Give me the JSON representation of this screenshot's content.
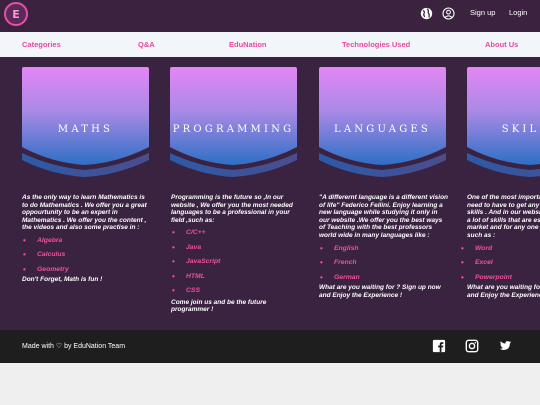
{
  "brand": {
    "logo_letter": "E",
    "logo_color": "#e84fa5"
  },
  "topbar": {
    "bg": "#3b2340",
    "icons": [
      "globe-icon",
      "user-circle-icon"
    ],
    "signup": "Sign up",
    "login": "Login"
  },
  "nav": {
    "items": [
      "Categories",
      "Q&A",
      "EduNation",
      "Technologies Used",
      "About Us"
    ],
    "color": "#e8489c"
  },
  "cards": [
    {
      "title": "MATHS",
      "paragraph": "As the only way to learn Mathematics is to do Mathematics . We offer you a great oppourtunity to be an expert in Mathematics . We offer you the content , the videos and also some practise in :",
      "items": [
        "Algebra",
        "Calculus",
        "Geometry"
      ],
      "after": "Don't Forget, Math is fun !"
    },
    {
      "title": "PROGRAMMING",
      "paragraph": "Programming is the future so ,In our website , We offer you the most needed languages to be a professional in your field ,such as:",
      "items": [
        "C/C++",
        "Java",
        "JavaScript",
        "HTML",
        "CSS"
      ],
      "after": "Come join us and be the future programmer !"
    },
    {
      "title": "LANGUAGES",
      "paragraph": "\"A differernt language is a different vision of life\" Federico Fellini. Enjoy learning a new language while studying it only in our website .We offer you the best ways of Teaching with the best professors world wide in many languages like :",
      "items": [
        "English",
        "French",
        "German"
      ],
      "after": "What are you waiting for ? Sign up now and Enjoy the Experience !"
    },
    {
      "title": "SKILLS",
      "paragraph": "One of the most important things you need to have to get any job is powerful skills . And in our website we provide you a lot of skills that are essential in the job market and for any one keen to learn, such as :",
      "items": [
        "Word",
        "Excel",
        "Powerpoint"
      ],
      "after": "What are you waiting for ? Sign up now and Enjoy the Experience !"
    }
  ],
  "footer": {
    "text": "Made with ♡ by EduNation Team",
    "icons": [
      "facebook-icon",
      "instagram-icon",
      "twitter-icon"
    ]
  },
  "colors": {
    "content_bg": "#3a2340",
    "accent_pink": "#f2509a",
    "card_top": "#e486f4",
    "card_bottom": "#2d6fc4"
  }
}
